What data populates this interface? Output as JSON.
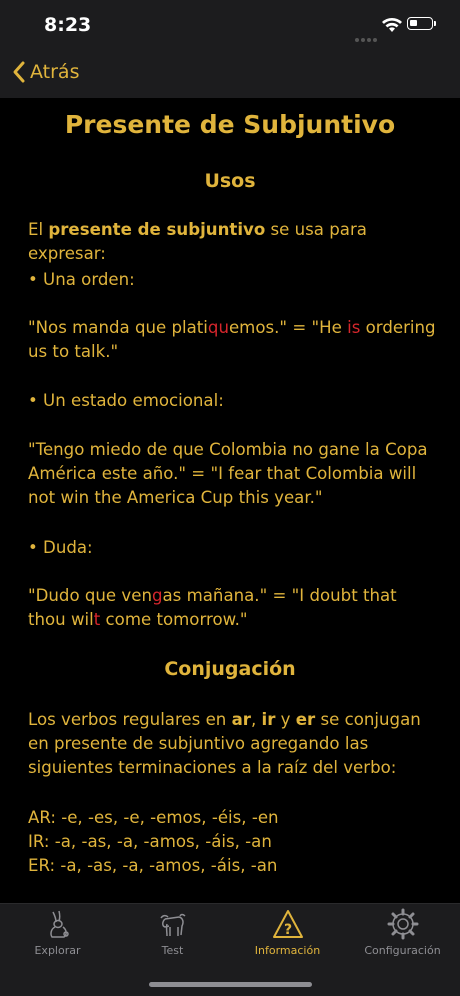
{
  "status": {
    "time": "8:23"
  },
  "nav": {
    "back_label": "Atrás"
  },
  "page": {
    "title": "Presente de Subjuntivo",
    "usos_heading": "Usos",
    "intro_a": "El ",
    "intro_bold": "presente de subjuntivo",
    "intro_b": " se usa para expresar:",
    "b1": "• Una orden:",
    "ex1_a": "\"Nos manda que plati",
    "ex1_red": "qu",
    "ex1_b": "emos.\" = \"He ",
    "ex1_red2": "is",
    "ex1_c": " ordering us to talk.\"",
    "b2": "• Un estado emocional:",
    "ex2": "\"Tengo miedo de que Colombia no gane la Copa América este año.\" = \"I fear that Colombia will not win the America Cup this year.\"",
    "b3": "• Duda:",
    "ex3_a": "\"Dudo que ven",
    "ex3_red": "g",
    "ex3_b": "as mañana.\" = \"I doubt that thou wil",
    "ex3_red2": "t",
    "ex3_c": " come tomorrow.\"",
    "conj_heading": "Conjugación",
    "conj_a": "Los verbos regulares en ",
    "conj_ar": "ar",
    "conj_sep1": ", ",
    "conj_ir": "ir",
    "conj_sep2": " y ",
    "conj_er": "er",
    "conj_b": " se conjugan en presente de subjuntivo agregando las siguientes terminaciones a la raíz del verbo:",
    "ar_line": "AR: -e, -es, -e, -emos, -éis, -en",
    "ir_line": "IR: -a, -as, -a, -amos, -áis, -an",
    "er_line": "ER: -a, -as, -a, -amos, -áis, -an"
  },
  "tabs": [
    {
      "label": "Explorar",
      "icon": "rabbit-icon"
    },
    {
      "label": "Test",
      "icon": "bull-icon"
    },
    {
      "label": "Información",
      "icon": "question-triangle-icon"
    },
    {
      "label": "Configuración",
      "icon": "gear-icon"
    }
  ],
  "colors": {
    "accent": "#e0b43c",
    "highlight": "#d6262c",
    "bar_bg": "#1c1c1e",
    "inactive": "#8e8e93"
  }
}
